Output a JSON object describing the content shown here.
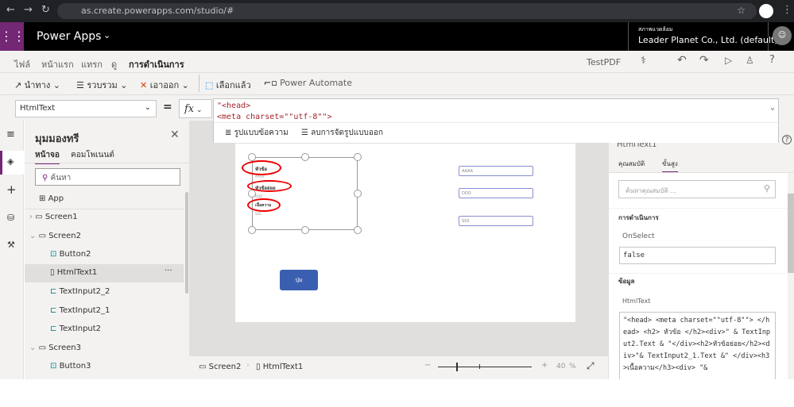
{
  "browser": {
    "url": "as.create.powerapps.com/studio/#"
  },
  "header": {
    "app_name": "Power Apps",
    "env_label": "สภาพแวดล้อม",
    "env_name": "Leader Planet Co., Ltd. (default)..."
  },
  "menu": {
    "tabs": [
      "ไฟล์",
      "หน้าแรก",
      "แทรก",
      "ดู",
      "การดำเนินการ"
    ],
    "active": 4,
    "app_title": "TestPDF"
  },
  "toolbar": {
    "navigate": "นำทาง",
    "collect": "รวบรวม",
    "remove": "เอาออก",
    "selected": "เลือกแล้ว",
    "power_automate": "Power Automate"
  },
  "formula": {
    "property": "HtmlText",
    "equals": "=",
    "fx": "fx",
    "line1": "\"<head>",
    "line2": "<meta charset=\"\"utf-8\"\">",
    "format_text": "รูปแบบข้อความ",
    "remove_format": "ลบการจัดรูปแบบออก"
  },
  "tree": {
    "title": "มุมมองทรี",
    "tabs": [
      "หน้าจอ",
      "คอมโพเนนต์"
    ],
    "search_placeholder": "ค้นหา",
    "items": [
      {
        "label": "App",
        "level": 0
      },
      {
        "label": "Screen1",
        "level": 0
      },
      {
        "label": "Screen2",
        "level": 0
      },
      {
        "label": "Button2",
        "level": 1
      },
      {
        "label": "HtmlText1",
        "level": 1
      },
      {
        "label": "TextInput2_2",
        "level": 1
      },
      {
        "label": "TextInput2_1",
        "level": 1
      },
      {
        "label": "TextInput2",
        "level": 1
      },
      {
        "label": "Screen3",
        "level": 0
      },
      {
        "label": "Button3",
        "level": 1
      }
    ],
    "selected": "HtmlText1",
    "more": "···"
  },
  "canvas": {
    "html": {
      "h1": "หัวข้อ",
      "v1": "AAAA",
      "h2": "หัวข้อย่อย",
      "v2": "DDD",
      "h3": "เนื้อความ",
      "v3": "SSS"
    },
    "inputs": [
      "AAAA",
      "DDD",
      "SSS"
    ],
    "button": "ปุ่ม"
  },
  "bottom": {
    "screen": "Screen2",
    "control": "HtmlText1",
    "zoom_minus": "−",
    "zoom_plus": "+",
    "zoom": "40",
    "zoom_unit": "%",
    "zoom_level": 40
  },
  "props": {
    "control": "HtmlText1",
    "tabs": [
      "คุณสมบัติ",
      "ขั้นสูง"
    ],
    "active_tab": 1,
    "search_placeholder": "ค้นหาคุณสมบัติ ...",
    "sec_action": "การดำเนินการ",
    "onselect_label": "OnSelect",
    "onselect_value": "false",
    "sec_data": "ข้อมูล",
    "htmltext_label": "HtmlText",
    "htmltext_value": "\"<head> <meta charset=\"\"utf-8\"\"> </head> <h2> หัวข้อ </h2><div>\" & TextInput2.Text & \"</div><h2>หัวข้อย่อย</h2><div>\"& TextInput2_1.Text &\" </div><h3>เนื้อความ</h3><div> \"&"
  },
  "colors": {
    "brand": "#742774",
    "button": "#3b5fb0",
    "annotation": "#e00000"
  }
}
